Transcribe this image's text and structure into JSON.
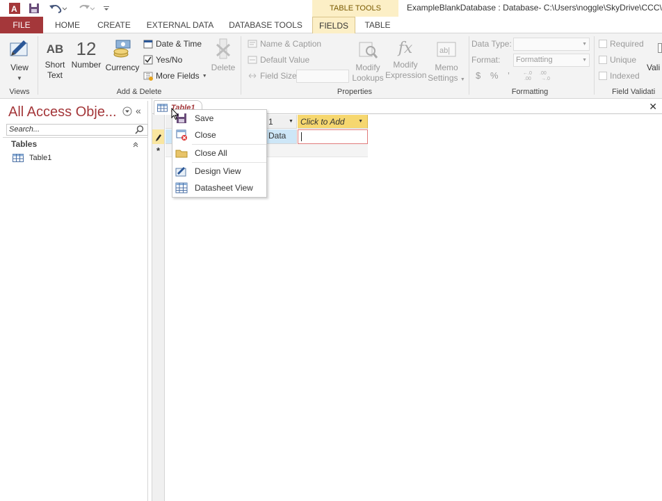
{
  "titlebar": {
    "context_group": "TABLE TOOLS",
    "window_title": "ExampleBlankDatabase : Database- C:\\Users\\noggle\\SkyDrive\\CCC\\D"
  },
  "tabs": [
    {
      "label": "FILE"
    },
    {
      "label": "HOME"
    },
    {
      "label": "CREATE"
    },
    {
      "label": "EXTERNAL DATA"
    },
    {
      "label": "DATABASE TOOLS"
    },
    {
      "label": "FIELDS"
    },
    {
      "label": "TABLE"
    }
  ],
  "ribbon": {
    "views": {
      "view_label": "View",
      "group_label": "Views"
    },
    "add_delete": {
      "short_text_line1": "Short",
      "short_text_line2": "Text",
      "number_glyph": "12",
      "number_label": "Number",
      "currency_label": "Currency",
      "date_time": "Date & Time",
      "yes_no": "Yes/No",
      "more_fields": "More Fields",
      "delete_label": "Delete",
      "group_label": "Add & Delete"
    },
    "properties": {
      "name_caption": "Name & Caption",
      "default_value": "Default Value",
      "field_size": "Field Size",
      "modify_lookups_1": "Modify",
      "modify_lookups_2": "Lookups",
      "modify_expression_1": "Modify",
      "modify_expression_2": "Expression",
      "memo_settings_1": "Memo",
      "memo_settings_2": "Settings",
      "group_label": "Properties"
    },
    "formatting": {
      "data_type_label": "Data Type:",
      "format_label": "Format:",
      "format_value": "Formatting",
      "currency_sym": "$",
      "percent_sym": "%",
      "comma_sym": "’",
      "group_label": "Formatting"
    },
    "validation": {
      "required": "Required",
      "unique": "Unique",
      "indexed": "Indexed",
      "vali_label": "Vali",
      "group_label": "Field Validati"
    }
  },
  "nav": {
    "title": "All Access Obje...",
    "search_placeholder": "Search...",
    "category": "Tables",
    "items": [
      {
        "label": "Table1"
      }
    ]
  },
  "document": {
    "tab_label": "Table1",
    "col1_header": "1",
    "col2_header": "Click to Add",
    "row1_value": "Data"
  },
  "context_menu": {
    "items": [
      {
        "label": "Save"
      },
      {
        "label": "Close"
      },
      {
        "label": "Close All"
      },
      {
        "label": "Design View"
      },
      {
        "label": "Datasheet View"
      }
    ]
  },
  "colors": {
    "access_red": "#a4373a",
    "contextual_tab": "#fcefc6",
    "add_column": "#f6d76f",
    "selected_cell": "#cde6f7"
  }
}
